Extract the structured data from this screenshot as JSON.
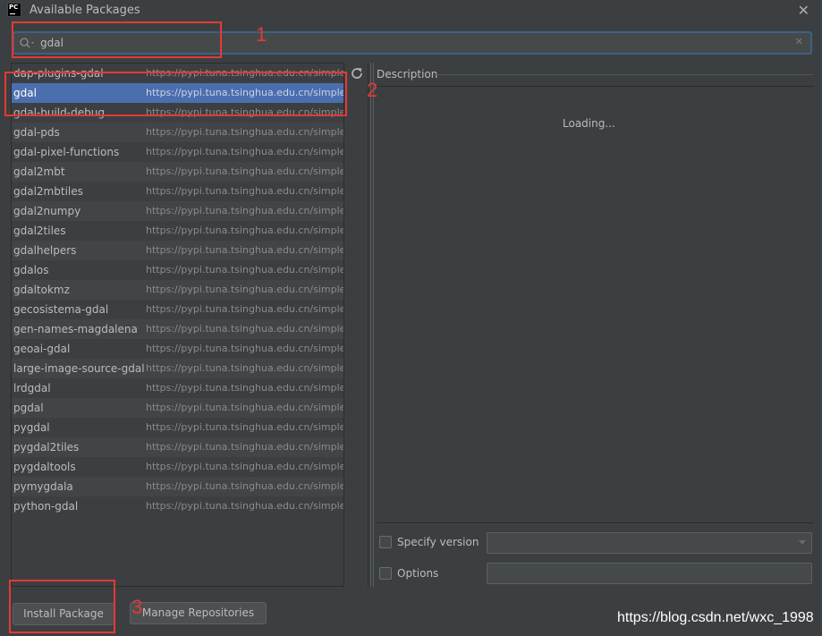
{
  "window": {
    "title": "Available Packages",
    "app_icon_text": "PC",
    "close_glyph": "✕"
  },
  "search": {
    "value": "gdal",
    "clear_glyph": "✕"
  },
  "packages": [
    {
      "name": "dap-plugins-gdal",
      "url": "https://pypi.tuna.tsinghua.edu.cn/simple/"
    },
    {
      "name": "gdal",
      "url": "https://pypi.tuna.tsinghua.edu.cn/simple/",
      "selected": true
    },
    {
      "name": "gdal-build-debug",
      "url": "https://pypi.tuna.tsinghua.edu.cn/simple/"
    },
    {
      "name": "gdal-pds",
      "url": "https://pypi.tuna.tsinghua.edu.cn/simple/"
    },
    {
      "name": "gdal-pixel-functions",
      "url": "https://pypi.tuna.tsinghua.edu.cn/simple/"
    },
    {
      "name": "gdal2mbt",
      "url": "https://pypi.tuna.tsinghua.edu.cn/simple/"
    },
    {
      "name": "gdal2mbtiles",
      "url": "https://pypi.tuna.tsinghua.edu.cn/simple/"
    },
    {
      "name": "gdal2numpy",
      "url": "https://pypi.tuna.tsinghua.edu.cn/simple/"
    },
    {
      "name": "gdal2tiles",
      "url": "https://pypi.tuna.tsinghua.edu.cn/simple/"
    },
    {
      "name": "gdalhelpers",
      "url": "https://pypi.tuna.tsinghua.edu.cn/simple/"
    },
    {
      "name": "gdalos",
      "url": "https://pypi.tuna.tsinghua.edu.cn/simple/"
    },
    {
      "name": "gdaltokmz",
      "url": "https://pypi.tuna.tsinghua.edu.cn/simple/"
    },
    {
      "name": "gecosistema-gdal",
      "url": "https://pypi.tuna.tsinghua.edu.cn/simple/"
    },
    {
      "name": "gen-names-magdalena",
      "url": "https://pypi.tuna.tsinghua.edu.cn/simple/"
    },
    {
      "name": "geoai-gdal",
      "url": "https://pypi.tuna.tsinghua.edu.cn/simple/"
    },
    {
      "name": "large-image-source-gdal",
      "url": "https://pypi.tuna.tsinghua.edu.cn/simple/"
    },
    {
      "name": "lrdgdal",
      "url": "https://pypi.tuna.tsinghua.edu.cn/simple/"
    },
    {
      "name": "pgdal",
      "url": "https://pypi.tuna.tsinghua.edu.cn/simple/"
    },
    {
      "name": "pygdal",
      "url": "https://pypi.tuna.tsinghua.edu.cn/simple/"
    },
    {
      "name": "pygdal2tiles",
      "url": "https://pypi.tuna.tsinghua.edu.cn/simple/"
    },
    {
      "name": "pygdaltools",
      "url": "https://pypi.tuna.tsinghua.edu.cn/simple/"
    },
    {
      "name": "pymygdala",
      "url": "https://pypi.tuna.tsinghua.edu.cn/simple/"
    },
    {
      "name": "python-gdal",
      "url": "https://pypi.tuna.tsinghua.edu.cn/simple/"
    }
  ],
  "description": {
    "label": "Description",
    "loading_text": "Loading..."
  },
  "options": {
    "specify_version_label": "Specify version",
    "specify_version_checked": false,
    "options_label": "Options",
    "options_checked": false,
    "version_value": "",
    "options_value": ""
  },
  "buttons": {
    "install_label": "Install Package",
    "manage_label": "Manage Repositories"
  },
  "annotations": [
    "1",
    "2",
    "3"
  ],
  "watermark": "https://blog.csdn.net/wxc_1998",
  "colors": {
    "background": "#3c3f41",
    "selection": "#4b6eaf",
    "annotation": "#e53935",
    "focus_border": "#3d6185"
  }
}
